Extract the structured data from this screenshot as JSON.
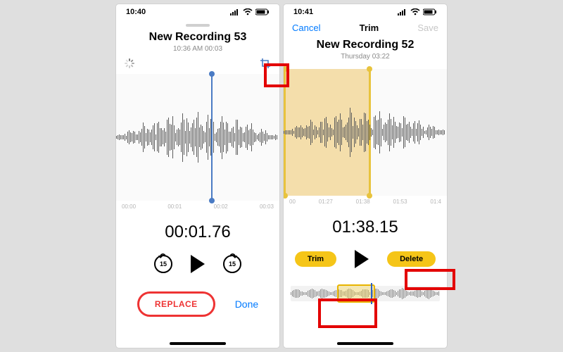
{
  "left": {
    "status_time": "10:40",
    "title": "New Recording 53",
    "subtitle": "10:36 AM  00:03",
    "ticks": [
      "00:00",
      "00:01",
      "00:02",
      "00:03"
    ],
    "bigtime": "00:01.76",
    "skip_amount": "15",
    "replace_label": "REPLACE",
    "done_label": "Done"
  },
  "right": {
    "status_time": "10:41",
    "nav_cancel": "Cancel",
    "nav_title": "Trim",
    "nav_save": "Save",
    "title": "New Recording 52",
    "subtitle": "Thursday  03:22",
    "ticks": [
      "00",
      "01:27",
      "01:38",
      "01:53",
      "01:4"
    ],
    "bigtime": "01:38.15",
    "trim_label": "Trim",
    "delete_label": "Delete"
  }
}
